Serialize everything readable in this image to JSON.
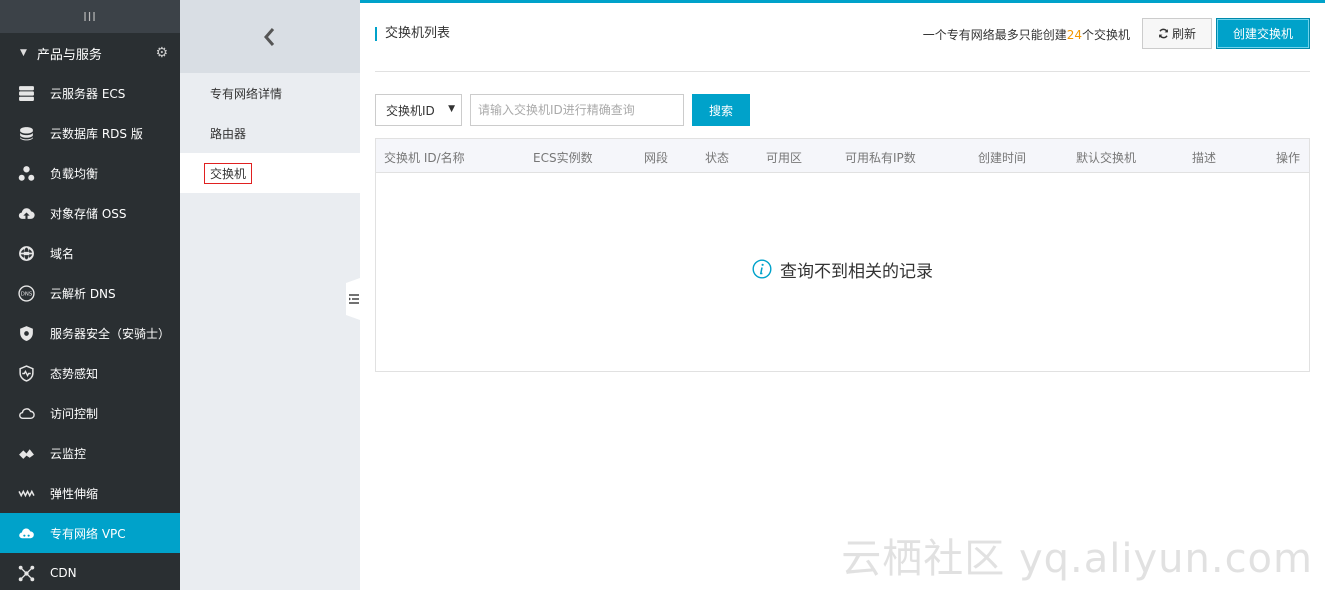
{
  "sidebar": {
    "handle": "III",
    "section_label": "产品与服务",
    "items": [
      {
        "label": "云服务器 ECS",
        "icon": "server-icon"
      },
      {
        "label": "云数据库 RDS 版",
        "icon": "database-icon"
      },
      {
        "label": "负载均衡",
        "icon": "load-balancer-icon"
      },
      {
        "label": "对象存储 OSS",
        "icon": "cloud-upload-icon"
      },
      {
        "label": "域名",
        "icon": "globe-icon"
      },
      {
        "label": "云解析 DNS",
        "icon": "dns-icon"
      },
      {
        "label": "服务器安全（安骑士）",
        "icon": "shield-icon"
      },
      {
        "label": "态势感知",
        "icon": "shield-pulse-icon"
      },
      {
        "label": "访问控制",
        "icon": "cloud-outline-icon"
      },
      {
        "label": "云监控",
        "icon": "monitor-icon"
      },
      {
        "label": "弹性伸缩",
        "icon": "scaling-icon"
      },
      {
        "label": "专有网络 VPC",
        "icon": "cloud-vpc-icon",
        "active": true
      },
      {
        "label": "CDN",
        "icon": "cdn-icon"
      }
    ]
  },
  "subnav": {
    "items": [
      {
        "label": "专有网络详情"
      },
      {
        "label": "路由器"
      },
      {
        "label": "交换机",
        "active": true
      }
    ]
  },
  "main": {
    "title": "交换机列表",
    "limit_prefix": "一个专有网络最多只能创建",
    "limit_number": "24",
    "limit_suffix": "个交换机",
    "refresh_label": "刷新",
    "create_label": "创建交换机",
    "search": {
      "select_value": "交换机ID",
      "placeholder": "请输入交换机ID进行精确查询",
      "button_label": "搜索"
    },
    "table": {
      "columns": [
        "交换机 ID/名称",
        "ECS实例数",
        "网段",
        "状态",
        "可用区",
        "可用私有IP数",
        "创建时间",
        "默认交换机",
        "描述",
        "操作"
      ],
      "empty_message": "查询不到相关的记录"
    }
  },
  "watermark": "云栖社区 yq.aliyun.com",
  "colors": {
    "accent": "#00a2ca",
    "sidebar_bg": "#2a2f32",
    "highlight_number": "#f39800"
  }
}
